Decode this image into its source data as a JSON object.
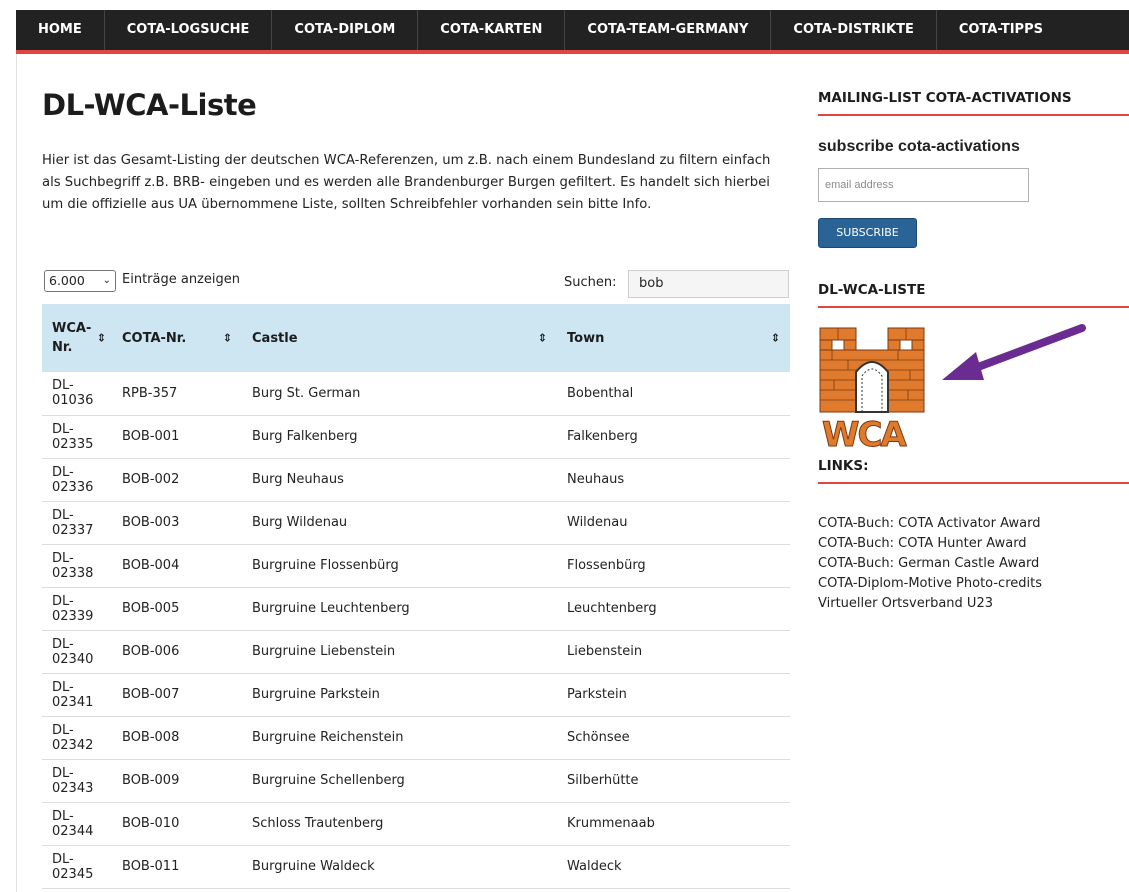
{
  "nav": [
    "HOME",
    "COTA-LOGSUCHE",
    "COTA-DIPLOM",
    "COTA-KARTEN",
    "COTA-TEAM-GERMANY",
    "COTA-DISTRIKTE",
    "COTA-TIPPS"
  ],
  "page": {
    "title": "DL-WCA-Liste",
    "intro": "Hier ist das Gesamt-Listing der deutschen WCA-Referenzen, um z.B. nach einem Bundesland zu filtern einfach als Suchbegriff z.B. BRB- eingeben und es werden alle Brandenburger Burgen gefiltert. Es handelt sich hierbei um die offizielle aus UA übernommene Liste, sollten Schreibfehler vorhanden sein bitte Info."
  },
  "controls": {
    "length_value": "6.000",
    "length_label": "Einträge anzeigen",
    "search_label": "Suchen:",
    "search_value": "bob"
  },
  "table": {
    "headers": [
      "WCA-Nr.",
      "COTA-Nr.",
      "Castle",
      "Town"
    ],
    "rows": [
      [
        "DL-01036",
        "RPB-357",
        "Burg St. German",
        "Bobenthal"
      ],
      [
        "DL-02335",
        "BOB-001",
        "Burg Falkenberg",
        "Falkenberg"
      ],
      [
        "DL-02336",
        "BOB-002",
        "Burg Neuhaus",
        "Neuhaus"
      ],
      [
        "DL-02337",
        "BOB-003",
        "Burg Wildenau",
        "Wildenau"
      ],
      [
        "DL-02338",
        "BOB-004",
        "Burgruine Flossenbürg",
        "Flossenbürg"
      ],
      [
        "DL-02339",
        "BOB-005",
        "Burgruine Leuchtenberg",
        "Leuchtenberg"
      ],
      [
        "DL-02340",
        "BOB-006",
        "Burgruine Liebenstein",
        "Liebenstein"
      ],
      [
        "DL-02341",
        "BOB-007",
        "Burgruine Parkstein",
        "Parkstein"
      ],
      [
        "DL-02342",
        "BOB-008",
        "Burgruine Reichenstein",
        "Schönsee"
      ],
      [
        "DL-02343",
        "BOB-009",
        "Burgruine Schellenberg",
        "Silberhütte"
      ],
      [
        "DL-02344",
        "BOB-010",
        "Schloss Trautenberg",
        "Krummenaab"
      ],
      [
        "DL-02345",
        "BOB-011",
        "Burgruine Waldeck",
        "Waldeck"
      ]
    ]
  },
  "sidebar": {
    "mailing_title": "MAILING-LIST COTA-ACTIVATIONS",
    "subscribe_title": "subscribe cota-activations",
    "email_placeholder": "email address",
    "subscribe_button": "SUBSCRIBE",
    "wca_title": "DL-WCA-LISTE",
    "wca_logo_text": "WCA",
    "links_title": "LINKS:",
    "links": [
      "COTA-Buch: COTA Activator Award",
      "COTA-Buch: COTA Hunter Award",
      "COTA-Buch: German Castle Award",
      "COTA-Diplom-Motive Photo-credits",
      "Virtueller Ortsverband U23"
    ]
  },
  "colors": {
    "nav_bg": "#222222",
    "accent_red": "#e0463f",
    "table_header_bg": "#cde6f2",
    "button_blue": "#2a6497",
    "logo_orange": "#e07a2c",
    "arrow_purple": "#6a2c91"
  },
  "icons": {
    "sort": "sort-both-icon",
    "select_chevron": "chevron-down-icon",
    "logo": "wca-castle-logo",
    "arrow": "purple-arrow-icon"
  }
}
